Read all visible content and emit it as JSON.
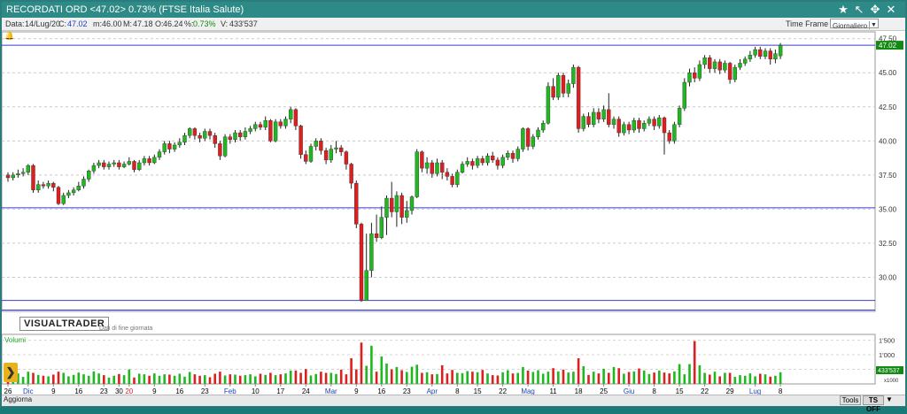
{
  "window": {
    "title": "RECORDATI ORD <47.02> 0.73% (FTSE Italia Salute)",
    "icons": [
      "star-icon",
      "cursor-icon",
      "crosshair-icon",
      "settings-icon",
      "close-icon"
    ]
  },
  "info": {
    "data_label": "Data:",
    "data_value": "14/Lug/20",
    "c_label": "C:",
    "c_value": "47.02",
    "m_label": "m:",
    "m_value": "46.00",
    "M_label": "M:",
    "M_value": "47.18",
    "o_label": "O:",
    "o_value": "46.24",
    "pct_label": "%:",
    "pct_value": "0.73%",
    "v_label": "V:",
    "v_value": "433'537"
  },
  "timeframe": {
    "label": "Time Frame",
    "selected": "Giornaliero"
  },
  "logo": "VISUALTRADER",
  "eod_note": "Dati di fine giornata",
  "volume_label": "Volumi",
  "toolbar": {
    "refresh": "Aggiorna",
    "tools": "Tools",
    "tsoff": "TS OFF"
  },
  "colors": {
    "up": "#1fb81f",
    "down": "#dd1f1f",
    "guide": "#3b3bcf",
    "last_price_bg": "#138a13"
  },
  "chart_data": {
    "type": "candlestick",
    "price_ticks": [
      47.5,
      45.0,
      42.5,
      40.0,
      37.5,
      35.0,
      32.5,
      30.0
    ],
    "price_ticks_label": [
      "47.50",
      "45.00",
      "42.50",
      "40.00",
      "37.50",
      "35.00",
      "32.50",
      "30.00"
    ],
    "price_range": [
      27.5,
      48.0
    ],
    "last_price": "47.02",
    "horizontal_lines": [
      47.02,
      35.1,
      28.3,
      27.6
    ],
    "volume_ticks_label": [
      "1'500",
      "1'000",
      "500"
    ],
    "volume_range": [
      0,
      1700
    ],
    "volume_unit": "x1000",
    "volume_last": "433'537",
    "x_labels": [
      {
        "i": 0,
        "t": "26",
        "c": "#000"
      },
      {
        "i": 4,
        "t": "Dic",
        "c": "#1f3fbf"
      },
      {
        "i": 9,
        "t": "9",
        "c": "#000"
      },
      {
        "i": 14,
        "t": "16",
        "c": "#000"
      },
      {
        "i": 19,
        "t": "23",
        "c": "#000"
      },
      {
        "i": 22,
        "t": "30",
        "c": "#000"
      },
      {
        "i": 24,
        "t": "20",
        "c": "#dd1f1f"
      },
      {
        "i": 29,
        "t": "9",
        "c": "#000"
      },
      {
        "i": 34,
        "t": "16",
        "c": "#000"
      },
      {
        "i": 39,
        "t": "23",
        "c": "#000"
      },
      {
        "i": 44,
        "t": "Feb",
        "c": "#1f3fbf"
      },
      {
        "i": 49,
        "t": "10",
        "c": "#000"
      },
      {
        "i": 54,
        "t": "17",
        "c": "#000"
      },
      {
        "i": 59,
        "t": "24",
        "c": "#000"
      },
      {
        "i": 64,
        "t": "Mar",
        "c": "#1f3fbf"
      },
      {
        "i": 69,
        "t": "9",
        "c": "#000"
      },
      {
        "i": 74,
        "t": "16",
        "c": "#000"
      },
      {
        "i": 79,
        "t": "23",
        "c": "#000"
      },
      {
        "i": 84,
        "t": "Apr",
        "c": "#1f3fbf"
      },
      {
        "i": 89,
        "t": "8",
        "c": "#000"
      },
      {
        "i": 93,
        "t": "15",
        "c": "#000"
      },
      {
        "i": 98,
        "t": "22",
        "c": "#000"
      },
      {
        "i": 103,
        "t": "Mag",
        "c": "#1f3fbf"
      },
      {
        "i": 108,
        "t": "11",
        "c": "#000"
      },
      {
        "i": 113,
        "t": "18",
        "c": "#000"
      },
      {
        "i": 118,
        "t": "25",
        "c": "#000"
      },
      {
        "i": 123,
        "t": "Giu",
        "c": "#1f3fbf"
      },
      {
        "i": 128,
        "t": "8",
        "c": "#000"
      },
      {
        "i": 133,
        "t": "15",
        "c": "#000"
      },
      {
        "i": 138,
        "t": "22",
        "c": "#000"
      },
      {
        "i": 143,
        "t": "29",
        "c": "#000"
      },
      {
        "i": 148,
        "t": "Lug",
        "c": "#1f3fbf"
      },
      {
        "i": 153,
        "t": "8",
        "c": "#000"
      }
    ],
    "candles": [
      [
        37.5,
        37.3,
        37.7,
        37.0
      ],
      [
        37.3,
        37.5,
        37.7,
        37.1
      ],
      [
        37.5,
        37.6,
        37.9,
        37.3
      ],
      [
        37.6,
        37.7,
        38.0,
        37.4
      ],
      [
        37.7,
        38.2,
        38.3,
        37.5
      ],
      [
        38.2,
        36.4,
        38.3,
        36.2
      ],
      [
        36.4,
        36.8,
        37.1,
        36.2
      ],
      [
        36.8,
        36.7,
        37.0,
        36.5
      ],
      [
        36.7,
        36.9,
        37.1,
        36.5
      ],
      [
        36.9,
        36.6,
        37.0,
        36.3
      ],
      [
        36.6,
        35.4,
        36.7,
        35.3
      ],
      [
        35.4,
        36.0,
        36.2,
        35.3
      ],
      [
        36.0,
        36.2,
        36.4,
        35.8
      ],
      [
        36.2,
        36.4,
        36.6,
        36.0
      ],
      [
        36.4,
        36.7,
        37.0,
        36.3
      ],
      [
        36.7,
        37.2,
        37.4,
        36.5
      ],
      [
        37.2,
        37.8,
        37.9,
        37.0
      ],
      [
        37.8,
        38.2,
        38.4,
        37.6
      ],
      [
        38.2,
        38.4,
        38.6,
        38.0
      ],
      [
        38.4,
        38.1,
        38.6,
        37.9
      ],
      [
        38.1,
        38.3,
        38.5,
        37.9
      ],
      [
        38.3,
        38.4,
        38.6,
        38.1
      ],
      [
        38.4,
        38.1,
        38.6,
        37.9
      ],
      [
        38.1,
        38.3,
        38.5,
        38.0
      ],
      [
        38.3,
        38.5,
        38.8,
        38.2
      ],
      [
        38.5,
        37.9,
        38.6,
        37.7
      ],
      [
        37.9,
        38.4,
        38.6,
        37.8
      ],
      [
        38.4,
        38.7,
        38.9,
        38.2
      ],
      [
        38.7,
        38.4,
        38.9,
        38.2
      ],
      [
        38.4,
        38.8,
        39.0,
        38.3
      ],
      [
        38.8,
        39.2,
        39.4,
        38.6
      ],
      [
        39.2,
        39.8,
        40.0,
        39.0
      ],
      [
        39.8,
        39.4,
        40.0,
        39.1
      ],
      [
        39.4,
        39.7,
        39.9,
        39.2
      ],
      [
        39.7,
        39.9,
        40.2,
        39.5
      ],
      [
        39.9,
        40.4,
        40.6,
        39.7
      ],
      [
        40.4,
        40.9,
        41.0,
        40.2
      ],
      [
        40.9,
        40.4,
        41.0,
        40.1
      ],
      [
        40.4,
        40.2,
        40.6,
        39.9
      ],
      [
        40.2,
        40.7,
        40.9,
        40.0
      ],
      [
        40.7,
        40.4,
        40.9,
        40.1
      ],
      [
        40.4,
        39.8,
        40.6,
        39.5
      ],
      [
        39.8,
        38.9,
        40.0,
        38.6
      ],
      [
        38.9,
        40.3,
        40.5,
        38.8
      ],
      [
        40.3,
        40.1,
        40.5,
        39.8
      ],
      [
        40.1,
        40.6,
        40.8,
        39.9
      ],
      [
        40.6,
        40.3,
        40.8,
        40.0
      ],
      [
        40.3,
        40.7,
        41.0,
        40.1
      ],
      [
        40.7,
        40.9,
        41.1,
        40.5
      ],
      [
        40.9,
        41.2,
        41.4,
        40.7
      ],
      [
        41.2,
        41.0,
        41.4,
        40.8
      ],
      [
        41.0,
        41.5,
        41.8,
        40.8
      ],
      [
        41.5,
        40.0,
        41.6,
        39.9
      ],
      [
        40.0,
        41.4,
        41.6,
        39.9
      ],
      [
        41.4,
        41.1,
        41.6,
        40.9
      ],
      [
        41.1,
        41.6,
        41.8,
        40.9
      ],
      [
        41.6,
        42.3,
        42.5,
        41.3
      ],
      [
        42.3,
        41.1,
        42.4,
        40.8
      ],
      [
        41.1,
        39.0,
        41.2,
        38.7
      ],
      [
        39.0,
        38.5,
        39.3,
        38.3
      ],
      [
        38.5,
        39.6,
        39.8,
        38.4
      ],
      [
        39.6,
        40.0,
        40.2,
        39.3
      ],
      [
        40.0,
        39.3,
        40.2,
        39.0
      ],
      [
        39.3,
        38.6,
        39.5,
        38.3
      ],
      [
        38.6,
        39.4,
        39.7,
        38.4
      ],
      [
        39.4,
        39.5,
        40.0,
        39.1
      ],
      [
        39.5,
        39.2,
        39.7,
        38.9
      ],
      [
        39.2,
        38.3,
        39.3,
        37.9
      ],
      [
        38.3,
        36.9,
        38.4,
        36.5
      ],
      [
        36.9,
        33.9,
        37.1,
        33.6
      ],
      [
        33.9,
        28.3,
        34.0,
        28.2
      ],
      [
        28.3,
        30.5,
        33.2,
        28.5
      ],
      [
        30.5,
        33.2,
        34.0,
        30.0
      ],
      [
        33.2,
        32.9,
        34.6,
        32.6
      ],
      [
        32.9,
        34.4,
        35.2,
        32.8
      ],
      [
        34.4,
        35.8,
        36.0,
        33.1
      ],
      [
        35.8,
        34.8,
        37.0,
        34.4
      ],
      [
        34.8,
        36.0,
        36.3,
        33.7
      ],
      [
        36.0,
        34.4,
        36.2,
        33.9
      ],
      [
        34.4,
        34.9,
        35.6,
        34.0
      ],
      [
        34.9,
        35.9,
        36.0,
        34.6
      ],
      [
        35.9,
        39.2,
        39.4,
        35.8
      ],
      [
        39.2,
        38.0,
        39.3,
        37.7
      ],
      [
        38.0,
        38.4,
        38.8,
        37.6
      ],
      [
        38.4,
        37.6,
        38.6,
        37.3
      ],
      [
        37.6,
        38.4,
        38.7,
        37.4
      ],
      [
        38.4,
        37.7,
        38.6,
        37.2
      ],
      [
        37.7,
        37.4,
        38.0,
        37.1
      ],
      [
        37.4,
        36.8,
        37.6,
        36.6
      ],
      [
        36.8,
        37.7,
        37.9,
        36.6
      ],
      [
        37.7,
        38.3,
        38.5,
        37.6
      ],
      [
        38.3,
        38.5,
        38.8,
        38.1
      ],
      [
        38.5,
        38.2,
        38.7,
        37.9
      ],
      [
        38.2,
        38.7,
        38.9,
        38.0
      ],
      [
        38.7,
        38.4,
        38.9,
        38.2
      ],
      [
        38.4,
        38.9,
        39.1,
        38.2
      ],
      [
        38.9,
        38.6,
        39.2,
        38.4
      ],
      [
        38.6,
        38.2,
        38.8,
        37.9
      ],
      [
        38.2,
        38.8,
        39.0,
        38.0
      ],
      [
        38.8,
        39.1,
        39.3,
        38.6
      ],
      [
        39.1,
        38.7,
        39.3,
        38.4
      ],
      [
        38.7,
        39.4,
        39.6,
        38.5
      ],
      [
        39.4,
        40.9,
        41.0,
        39.2
      ],
      [
        40.9,
        39.6,
        41.0,
        39.3
      ],
      [
        39.6,
        40.3,
        40.5,
        39.4
      ],
      [
        40.3,
        40.8,
        41.0,
        40.1
      ],
      [
        40.8,
        41.3,
        41.5,
        40.6
      ],
      [
        41.3,
        44.0,
        44.3,
        41.2
      ],
      [
        44.0,
        43.2,
        44.6,
        43.0
      ],
      [
        43.2,
        44.8,
        45.0,
        43.0
      ],
      [
        44.8,
        43.5,
        45.0,
        43.2
      ],
      [
        43.5,
        44.2,
        44.5,
        43.2
      ],
      [
        44.2,
        45.4,
        45.6,
        43.9
      ],
      [
        45.4,
        40.9,
        45.5,
        40.6
      ],
      [
        40.9,
        41.8,
        42.0,
        40.7
      ],
      [
        41.8,
        41.2,
        42.1,
        41.0
      ],
      [
        41.2,
        42.1,
        42.4,
        41.0
      ],
      [
        42.1,
        41.6,
        42.4,
        41.3
      ],
      [
        41.6,
        42.3,
        42.6,
        41.4
      ],
      [
        42.3,
        41.2,
        43.5,
        41.0
      ],
      [
        41.2,
        41.6,
        41.8,
        40.9
      ],
      [
        41.6,
        40.6,
        41.8,
        40.3
      ],
      [
        40.6,
        41.2,
        41.4,
        40.4
      ],
      [
        41.2,
        40.8,
        41.4,
        40.5
      ],
      [
        40.8,
        41.5,
        41.7,
        40.6
      ],
      [
        41.5,
        40.9,
        41.7,
        40.6
      ],
      [
        40.9,
        41.3,
        41.5,
        40.7
      ],
      [
        41.3,
        41.6,
        41.8,
        41.1
      ],
      [
        41.6,
        41.1,
        41.8,
        40.8
      ],
      [
        41.1,
        41.7,
        41.9,
        40.9
      ],
      [
        41.7,
        40.6,
        41.8,
        39.0
      ],
      [
        40.6,
        40.0,
        40.8,
        39.8
      ],
      [
        40.0,
        41.2,
        41.4,
        39.8
      ],
      [
        41.2,
        42.4,
        42.6,
        41.0
      ],
      [
        42.4,
        44.3,
        44.6,
        42.2
      ],
      [
        44.3,
        45.0,
        45.3,
        44.0
      ],
      [
        45.0,
        44.6,
        45.4,
        44.3
      ],
      [
        44.6,
        45.6,
        45.9,
        44.4
      ],
      [
        45.6,
        46.1,
        46.3,
        45.3
      ],
      [
        46.1,
        45.3,
        46.3,
        45.0
      ],
      [
        45.3,
        45.8,
        46.0,
        45.0
      ],
      [
        45.8,
        45.2,
        46.0,
        44.9
      ],
      [
        45.2,
        45.7,
        45.9,
        45.0
      ],
      [
        45.7,
        44.5,
        45.8,
        44.2
      ],
      [
        44.5,
        45.4,
        45.6,
        44.3
      ],
      [
        45.4,
        45.7,
        46.0,
        45.2
      ],
      [
        45.7,
        46.0,
        46.2,
        45.5
      ],
      [
        46.0,
        46.3,
        46.6,
        45.8
      ],
      [
        46.3,
        46.7,
        46.9,
        46.1
      ],
      [
        46.7,
        46.2,
        46.9,
        46.0
      ],
      [
        46.2,
        46.6,
        46.8,
        46.0
      ],
      [
        46.6,
        46.0,
        46.8,
        45.6
      ],
      [
        46.0,
        46.4,
        46.7,
        45.7
      ],
      [
        46.24,
        47.02,
        47.18,
        46.0
      ]
    ],
    "volumes": [
      300,
      260,
      360,
      240,
      420,
      380,
      310,
      280,
      260,
      320,
      420,
      380,
      260,
      310,
      390,
      330,
      280,
      430,
      360,
      300,
      220,
      280,
      340,
      300,
      500,
      220,
      350,
      330,
      280,
      360,
      280,
      330,
      320,
      280,
      350,
      250,
      410,
      330,
      280,
      300,
      230,
      350,
      420,
      290,
      330,
      320,
      280,
      300,
      330,
      260,
      350,
      310,
      380,
      300,
      330,
      360,
      460,
      460,
      380,
      510,
      290,
      340,
      420,
      380,
      380,
      340,
      490,
      330,
      880,
      500,
      1420,
      620,
      1310,
      420,
      940,
      700,
      500,
      580,
      470,
      410,
      590,
      660,
      380,
      400,
      330,
      340,
      640,
      360,
      480,
      380,
      370,
      440,
      420,
      400,
      480,
      360,
      300,
      290,
      400,
      470,
      360,
      380,
      580,
      460,
      410,
      470,
      350,
      420,
      540,
      430,
      490,
      390,
      420,
      880,
      610,
      310,
      420,
      360,
      520,
      380,
      580,
      540,
      350,
      410,
      430,
      530,
      460,
      340,
      390,
      460,
      390,
      360,
      430,
      680,
      330,
      680,
      1470,
      640,
      380,
      320,
      420,
      260,
      380,
      380,
      240,
      300,
      280,
      360,
      260,
      350,
      330,
      250,
      280,
      400
    ]
  }
}
